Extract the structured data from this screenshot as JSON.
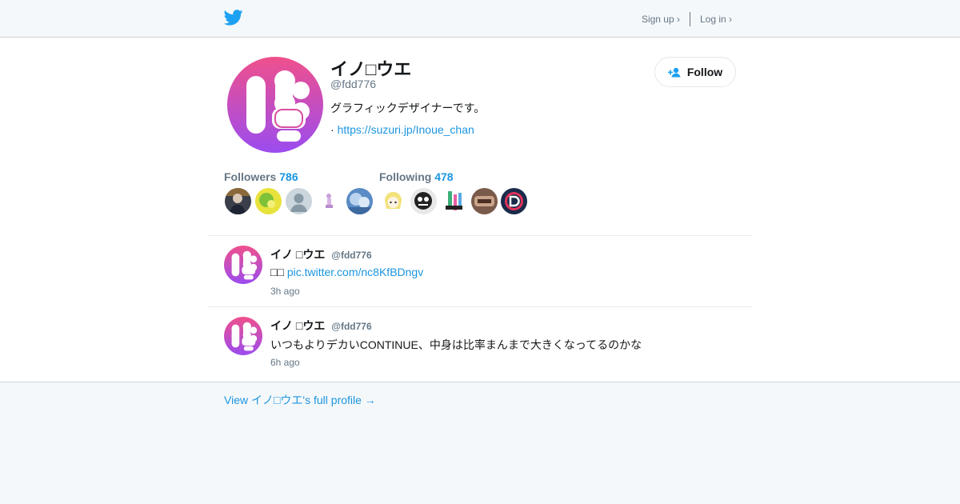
{
  "header": {
    "logo_icon": "twitter-bird-icon",
    "signup_label": "Sign up ›",
    "login_label": "Log in ›"
  },
  "profile": {
    "display_name": "イノ□ウエ",
    "handle": "@fdd776",
    "bio": "グラフィックデザイナーです。",
    "url_prefix": "·",
    "url": "https://suzuri.jp/Inoue_chan",
    "follow_label": "Follow",
    "followers_label": "Followers",
    "followers_count": "786",
    "following_label": "Following",
    "following_count": "478"
  },
  "tweets": [
    {
      "name": "イノ □ウエ",
      "handle": "@fdd776",
      "text_prefix": "□□",
      "link": "pic.twitter.com/nc8KfBDngv",
      "time": "3h ago"
    },
    {
      "name": "イノ □ウエ",
      "handle": "@fdd776",
      "text": "いつもよりデカいCONTINUE、中身は比率まんまで大きくなってるのかな",
      "time": "6h ago"
    }
  ],
  "footer": {
    "full_profile_label": "View イノ□ウエ's full profile →"
  },
  "colors": {
    "accent": "#1b95e0",
    "avatar_gradient_top": "#f0508c",
    "avatar_gradient_bottom": "#9b4cf0",
    "muted": "#657786"
  }
}
